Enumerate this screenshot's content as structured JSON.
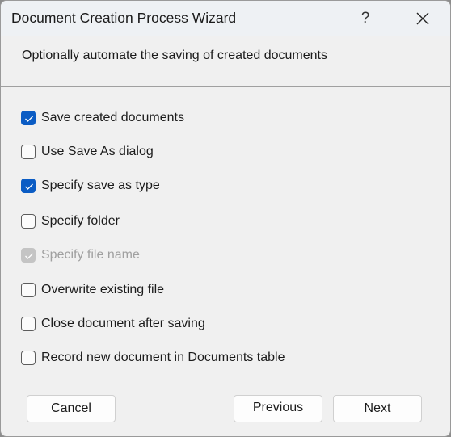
{
  "window": {
    "title": "Document Creation Process Wizard",
    "help_label": "?",
    "close_icon": "close-icon"
  },
  "header": {
    "subtitle": "Optionally automate the saving of created documents"
  },
  "options": [
    {
      "label": "Save created documents",
      "checked": true,
      "enabled": true
    },
    {
      "label": "Use Save As dialog",
      "checked": false,
      "enabled": true
    },
    {
      "label": "Specify save as type",
      "checked": true,
      "enabled": true
    },
    {
      "label": "Specify folder",
      "checked": false,
      "enabled": true
    },
    {
      "label": "Specify file name",
      "checked": true,
      "enabled": false
    },
    {
      "label": "Overwrite existing file",
      "checked": false,
      "enabled": true
    },
    {
      "label": "Close document after saving",
      "checked": false,
      "enabled": true
    },
    {
      "label": "Record new document in Documents table",
      "checked": false,
      "enabled": true
    }
  ],
  "footer": {
    "cancel_label": "Cancel",
    "previous_label": "Previous",
    "next_label": "Next"
  },
  "colors": {
    "accent": "#0b5cc4",
    "disabled": "#c4c4c4"
  }
}
